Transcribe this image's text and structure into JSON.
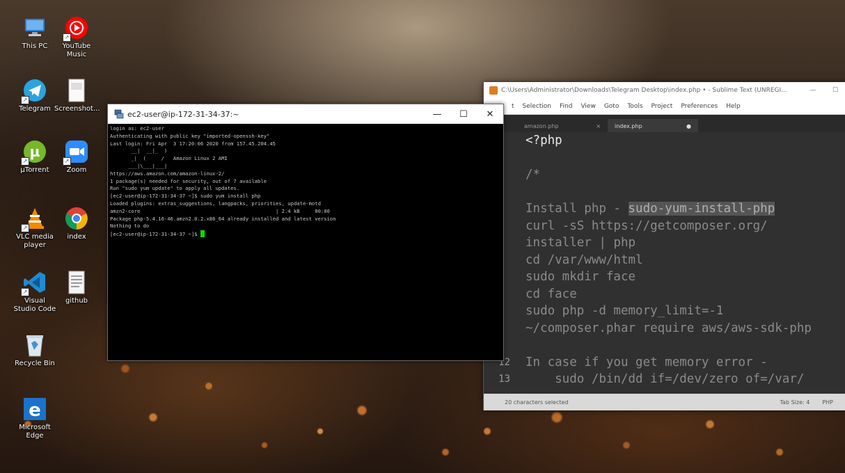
{
  "desktop": {
    "icons": [
      {
        "label": "This PC",
        "name": "this-pc-icon"
      },
      {
        "label": "YouTube Music",
        "name": "youtube-music-icon"
      },
      {
        "label": "Telegram",
        "name": "telegram-icon"
      },
      {
        "label": "Screenshot...",
        "name": "screenshot-file-icon"
      },
      {
        "label": "µTorrent",
        "name": "utorrent-icon"
      },
      {
        "label": "Zoom",
        "name": "zoom-icon"
      },
      {
        "label": "VLC media player",
        "name": "vlc-icon"
      },
      {
        "label": "index",
        "name": "chrome-index-icon"
      },
      {
        "label": "Visual Studio Code",
        "name": "vscode-icon"
      },
      {
        "label": "github",
        "name": "github-file-icon"
      },
      {
        "label": "Recycle Bin",
        "name": "recycle-bin-icon"
      },
      {
        "label": "Microsoft Edge",
        "name": "edge-icon"
      }
    ]
  },
  "putty": {
    "title": "ec2-user@ip-172-31-34-37:~",
    "minimize": "—",
    "maximize": "☐",
    "close": "✕",
    "lines": [
      "login as: ec2-user",
      "Authenticating with public key \"imported-openssh-key\"",
      "Last login: Fri Apr  3 17:20:06 2020 from 157.45.204.45",
      "",
      "       __|  __|_  )",
      "       _|  (     /   Amazon Linux 2 AMI",
      "      ___|\\___|___|",
      "",
      "https://aws.amazon.com/amazon-linux-2/",
      "1 package(s) needed for security, out of 7 available",
      "Run \"sudo yum update\" to apply all updates.",
      "[ec2-user@ip-172-31-34-37 ~]$ sudo yum install php",
      "Loaded plugins: extras_suggestions, langpacks, priorities, update-motd",
      "amzn2-core                                             | 2.4 kB     00:00",
      "Package php-5.4.16-46.amzn2.0.2.x86_64 already installed and latest version",
      "Nothing to do",
      "[ec2-user@ip-172-31-34-37 ~]$ "
    ]
  },
  "sublime": {
    "title": "C:\\Users\\Administrator\\Downloads\\Telegram Desktop\\index.php • - Sublime Text (UNREGI...",
    "minimize": "—",
    "maximize": "☐",
    "menu": [
      "t",
      "Selection",
      "Find",
      "View",
      "Goto",
      "Tools",
      "Project",
      "Preferences",
      "Help"
    ],
    "tabs": [
      {
        "label": "amazon.php",
        "close": "×"
      },
      {
        "label": "index.php",
        "close": "●"
      }
    ],
    "lines": [
      {
        "num": "",
        "text": "<?php",
        "cls": "php"
      },
      {
        "num": "",
        "text": "",
        "cls": ""
      },
      {
        "num": "",
        "text": "/*",
        "cls": "comment"
      },
      {
        "num": "",
        "text": "",
        "cls": ""
      },
      {
        "num": "",
        "text": "Install php - ",
        "sel": "sudo-yum-install-php",
        "cls": "comment"
      },
      {
        "num": "",
        "text": "curl -sS https://getcomposer.org/",
        "cls": "comment"
      },
      {
        "num": "",
        "text": "installer | php",
        "cls": "comment"
      },
      {
        "num": "",
        "text": "cd /var/www/html",
        "cls": "comment"
      },
      {
        "num": "",
        "text": "sudo mkdir face",
        "cls": "comment"
      },
      {
        "num": "",
        "text": "cd face",
        "cls": "comment"
      },
      {
        "num": "",
        "text": "sudo php -d memory_limit=-1",
        "cls": "comment"
      },
      {
        "num": "",
        "text": "~/composer.phar require aws/aws-sdk-php",
        "cls": "comment"
      },
      {
        "num": "",
        "text": "",
        "cls": ""
      },
      {
        "num": "12",
        "text": "In case if you get memory error -",
        "cls": "comment"
      },
      {
        "num": "13",
        "text": "    sudo /bin/dd if=/dev/zero of=/var/",
        "cls": "comment"
      }
    ],
    "status_left": "20 characters selected",
    "status_tab": "Tab Size: 4",
    "status_syntax": "PHP"
  }
}
